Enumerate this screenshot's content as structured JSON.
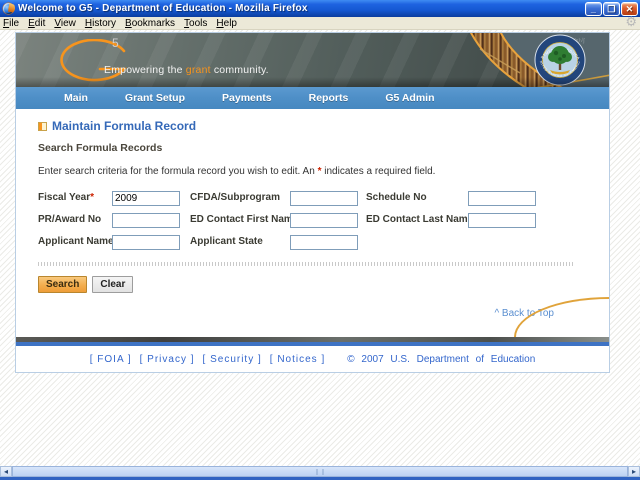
{
  "window": {
    "title": "Welcome to G5 - Department of Education - Mozilla Firefox",
    "controls": {
      "minimize": "_",
      "restore": "❐",
      "close": "✕"
    }
  },
  "menubar": {
    "items": [
      "File",
      "Edit",
      "View",
      "History",
      "Bookmarks",
      "Tools",
      "Help"
    ]
  },
  "banner": {
    "logo_letter": "G",
    "logo_number": "5",
    "tagline_prefix": "Empowering the ",
    "tagline_accent": "grant",
    "tagline_suffix": " community."
  },
  "navbar": {
    "items": [
      "Main",
      "Grant Setup",
      "Payments",
      "Reports",
      "G5 Admin"
    ]
  },
  "page": {
    "title": "Maintain Formula Record",
    "section_title": "Search Formula Records",
    "instruction_before": "Enter search criteria for the formula record you wish to edit. An ",
    "instruction_star": "*",
    "instruction_after": " indicates a required field.",
    "back_to_top": "^ Back to Top"
  },
  "form": {
    "required_marker": "*",
    "fields": {
      "fiscal_year": {
        "label": "Fiscal Year",
        "value": "2009"
      },
      "cfda": {
        "label": "CFDA/Subprogram",
        "value": ""
      },
      "schedule_no": {
        "label": "Schedule No",
        "value": ""
      },
      "pr_award_no": {
        "label": "PR/Award No",
        "value": ""
      },
      "ed_contact_first": {
        "label": "ED Contact First Name",
        "value": ""
      },
      "ed_contact_last": {
        "label": "ED Contact Last Name",
        "value": ""
      },
      "applicant_name": {
        "label": "Applicant Name",
        "value": ""
      },
      "applicant_state": {
        "label": "Applicant State",
        "value": ""
      }
    },
    "buttons": {
      "search": "Search",
      "clear": "Clear"
    }
  },
  "footer": {
    "links": [
      "[ FOIA ]",
      "[ Privacy ]",
      "[ Security ]",
      "[ Notices ]"
    ],
    "copyright": "© 2007 U.S. Department of Education"
  },
  "colors": {
    "accent_orange": "#F7941D",
    "nav_blue": "#4E8FC7",
    "link_blue": "#3366CC",
    "required_red": "#CC2200",
    "search_button": "#F3AB4A",
    "title_blue": "#3569B8"
  }
}
